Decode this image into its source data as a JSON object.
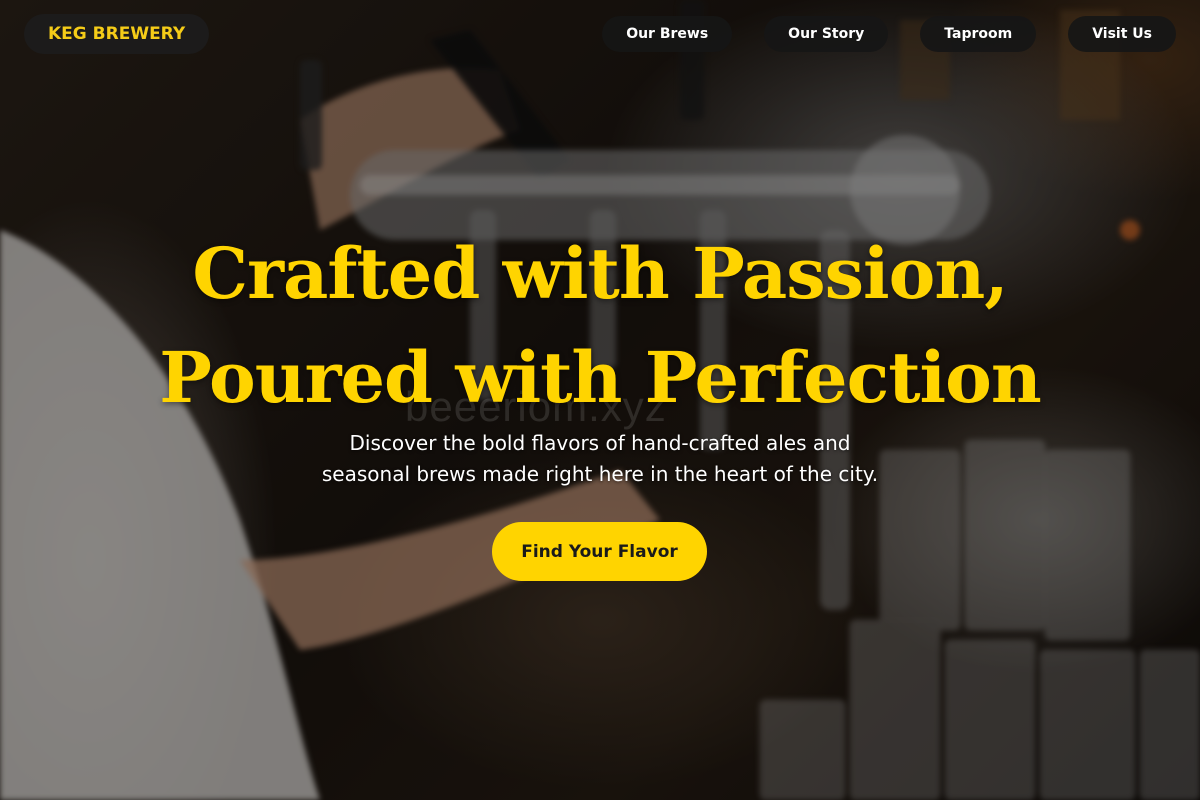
{
  "brand": {
    "logo_label": "KEG BREWERY",
    "accent_color": "#ffd400"
  },
  "nav": {
    "items": [
      {
        "label": "Our Brews"
      },
      {
        "label": "Our Story"
      },
      {
        "label": "Taproom"
      },
      {
        "label": "Visit Us"
      }
    ]
  },
  "hero": {
    "headline_line1": "Crafted with Passion,",
    "headline_line2": "Poured with Perfection",
    "subtext_line1": "Discover the bold flavors of hand-crafted ales and",
    "subtext_line2": "seasonal brews made right here in the heart of the city.",
    "cta_label": "Find Your Flavor",
    "watermark": "beeeriom.xyz"
  }
}
